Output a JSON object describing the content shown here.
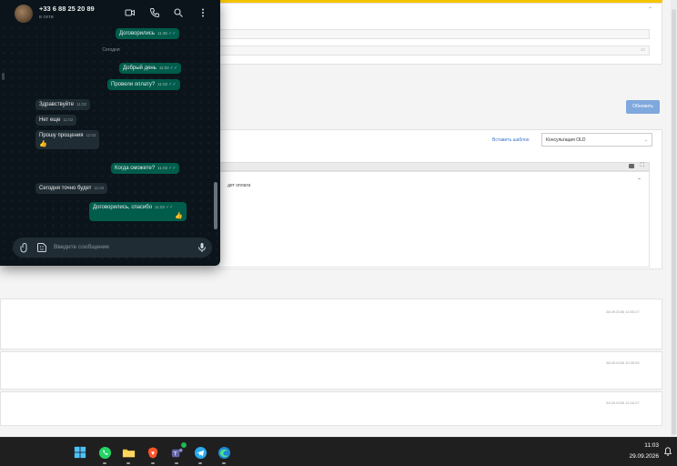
{
  "whatsapp": {
    "contact": {
      "name": "+33 6 88 25 20 89",
      "status": "в сети"
    },
    "day_separator": "Сегодня",
    "messages": [
      {
        "dir": "out",
        "text": "Договорились",
        "time": "11:36"
      },
      {
        "dir": "out",
        "text": "Добрый день",
        "time": "11:02"
      },
      {
        "dir": "out",
        "text": "Провели оплату?",
        "time": "11:02"
      },
      {
        "dir": "in",
        "text": "Здравствуйте",
        "time": "11:02"
      },
      {
        "dir": "in",
        "text": "Нет еще",
        "time": "11:02"
      },
      {
        "dir": "in",
        "text": "Прошу прощения",
        "time": "11:02",
        "reaction": "👍"
      },
      {
        "dir": "out",
        "text": "Когда сможете?",
        "time": "11:02"
      },
      {
        "dir": "in",
        "text": "Сегодня точно будет",
        "time": "11:02"
      },
      {
        "dir": "out",
        "text": "Договорились, спасибо",
        "time": "11:02",
        "reaction": "👍"
      }
    ],
    "input_placeholder": "Введите сообщение",
    "icons": [
      "video-icon",
      "phone-icon",
      "search-icon",
      "menu-icon",
      "attach-icon",
      "sticker-icon",
      "mic-icon"
    ]
  },
  "crm": {
    "refresh_button": "Обновить",
    "insert_template_link": "Вставить шаблон",
    "template_select_value": "Консультация OLD",
    "editor_text_fragment": "дет оплата",
    "history_timestamps": [
      "28.09.2026 14:03:27",
      "28.09.2026 10:39:52",
      "24.09.2026 12:15:27"
    ]
  },
  "taskbar": {
    "apps": [
      "windows-start",
      "whatsapp",
      "file-explorer",
      "brave-browser",
      "teams",
      "telegram",
      "edge-browser"
    ],
    "time": "11:03",
    "date": "29.09.2026"
  },
  "colors": {
    "wa_out": "#005c4b",
    "wa_in": "#202c33",
    "wa_bg": "#0b141a",
    "accent_yellow": "#f5c400"
  }
}
